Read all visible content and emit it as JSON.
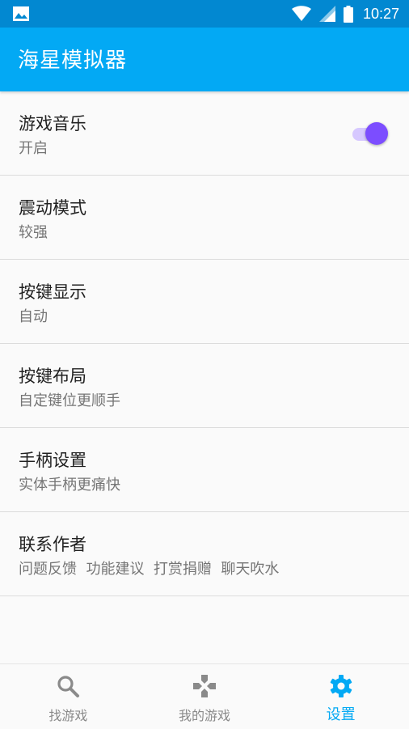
{
  "status_bar": {
    "time": "10:27",
    "icons": [
      "image-icon",
      "wifi-icon",
      "signal-icon",
      "battery-icon"
    ]
  },
  "app_bar": {
    "title": "海星模拟器"
  },
  "settings": [
    {
      "title": "游戏音乐",
      "subtitle": "开启",
      "toggle": true
    },
    {
      "title": "震动模式",
      "subtitle": "较强"
    },
    {
      "title": "按键显示",
      "subtitle": "自动"
    },
    {
      "title": "按键布局",
      "subtitle": "自定键位更顺手"
    },
    {
      "title": "手柄设置",
      "subtitle": "实体手柄更痛快"
    },
    {
      "title": "联系作者",
      "subtitle": "问题反馈  功能建议  打赏捐赠  聊天吹水"
    }
  ],
  "bottom_nav": [
    {
      "label": "找游戏",
      "icon": "search-icon"
    },
    {
      "label": "我的游戏",
      "icon": "gamepad-icon"
    },
    {
      "label": "设置",
      "icon": "settings-gear-icon",
      "active": true
    }
  ],
  "colors": {
    "status_bar": "#0288d1",
    "app_bar": "#03a9f4",
    "switch_thumb": "#7c4dff",
    "switch_track": "#d6c8ff",
    "active_nav": "#03a9f4",
    "inactive_nav": "#8a8a8a"
  }
}
